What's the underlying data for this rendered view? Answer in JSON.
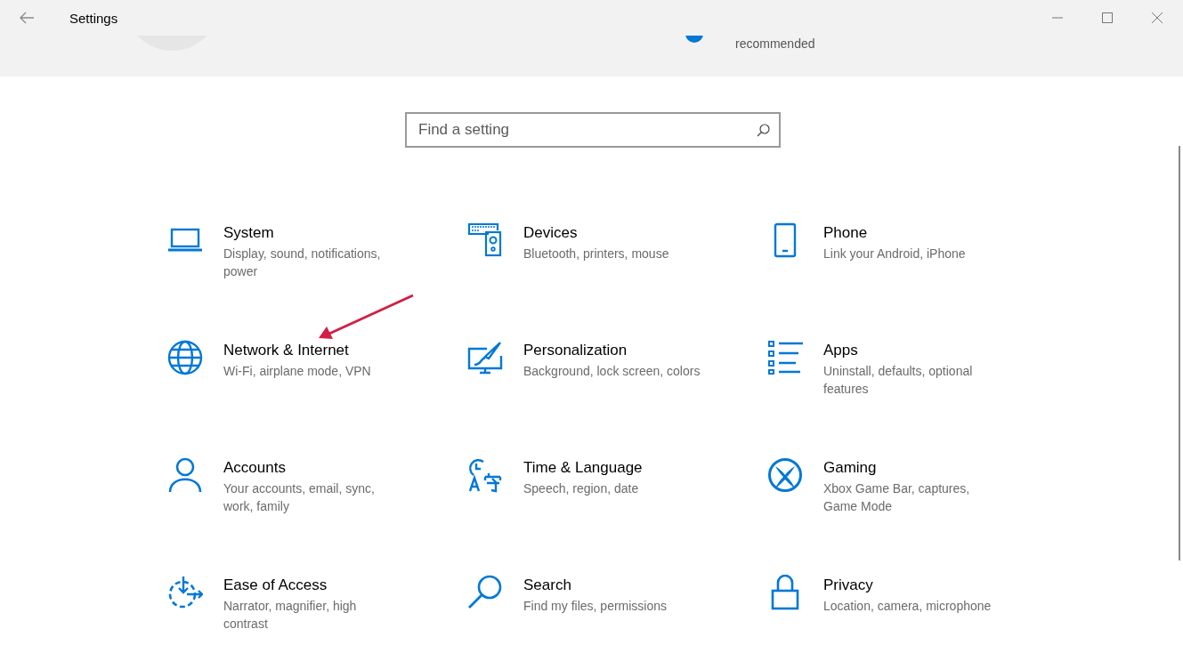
{
  "window": {
    "title": "Settings"
  },
  "header": {
    "status_text": "recommended"
  },
  "search": {
    "placeholder": "Find a setting"
  },
  "categories": [
    {
      "kind": "system",
      "title": "System",
      "description": "Display, sound, notifications, power"
    },
    {
      "kind": "devices",
      "title": "Devices",
      "description": "Bluetooth, printers, mouse"
    },
    {
      "kind": "phone",
      "title": "Phone",
      "description": "Link your Android, iPhone"
    },
    {
      "kind": "network",
      "title": "Network & Internet",
      "description": "Wi-Fi, airplane mode, VPN"
    },
    {
      "kind": "personalization",
      "title": "Personalization",
      "description": "Background, lock screen, colors"
    },
    {
      "kind": "apps",
      "title": "Apps",
      "description": "Uninstall, defaults, optional features"
    },
    {
      "kind": "accounts",
      "title": "Accounts",
      "description": "Your accounts, email, sync, work, family"
    },
    {
      "kind": "time",
      "title": "Time & Language",
      "description": "Speech, region, date"
    },
    {
      "kind": "gaming",
      "title": "Gaming",
      "description": "Xbox Game Bar, captures, Game Mode"
    },
    {
      "kind": "ease",
      "title": "Ease of Access",
      "description": "Narrator, magnifier, high contrast"
    },
    {
      "kind": "search",
      "title": "Search",
      "description": "Find my files, permissions"
    },
    {
      "kind": "privacy",
      "title": "Privacy",
      "description": "Location, camera, microphone"
    }
  ]
}
